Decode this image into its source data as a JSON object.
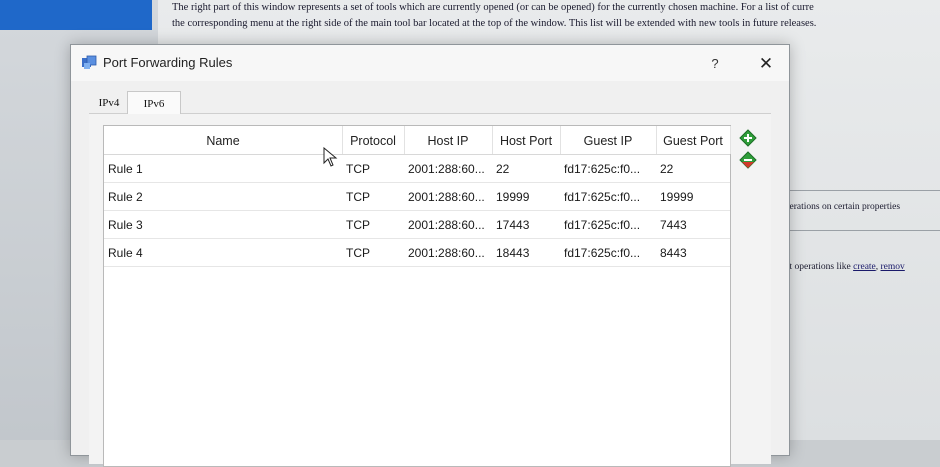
{
  "background": {
    "doc_line_1": "The right part of this window represents a set of tools which are currently opened (or can be opened) for the currently chosen machine. For a list of curre",
    "doc_line_2": "the corresponding menu at the right side of the main tool bar located at the top of the window. This list will be extended with new tools in future releases.",
    "right_fragment_1": "operations on certain properties",
    "right_fragment_2_prefix": "hot operations like ",
    "right_fragment_2_link1": "create",
    "right_fragment_2_sep": ", ",
    "right_fragment_2_link2": "remov"
  },
  "dialog": {
    "title": "Port Forwarding Rules",
    "help_label": "?",
    "close_label": "✕",
    "tabs": [
      {
        "label": "IPv4"
      },
      {
        "label": "IPv6"
      }
    ],
    "columns": [
      "Name",
      "Protocol",
      "Host IP",
      "Host Port",
      "Guest IP",
      "Guest Port"
    ],
    "rows": [
      {
        "name": "Rule 1",
        "protocol": "TCP",
        "host_ip": "2001:288:60...",
        "host_port": "22",
        "guest_ip": "fd17:625c:f0...",
        "guest_port": "22"
      },
      {
        "name": "Rule 2",
        "protocol": "TCP",
        "host_ip": "2001:288:60...",
        "host_port": "19999",
        "guest_ip": "fd17:625c:f0...",
        "guest_port": "19999"
      },
      {
        "name": "Rule 3",
        "protocol": "TCP",
        "host_ip": "2001:288:60...",
        "host_port": "17443",
        "guest_ip": "fd17:625c:f0...",
        "guest_port": "7443"
      },
      {
        "name": "Rule 4",
        "protocol": "TCP",
        "host_ip": "2001:288:60...",
        "host_port": "18443",
        "guest_ip": "fd17:625c:f0...",
        "guest_port": "8443"
      }
    ],
    "add_icon": "add-rule-icon",
    "remove_icon": "remove-rule-icon",
    "accent_green": "#2f9e3a",
    "accent_red": "#d0392b"
  }
}
